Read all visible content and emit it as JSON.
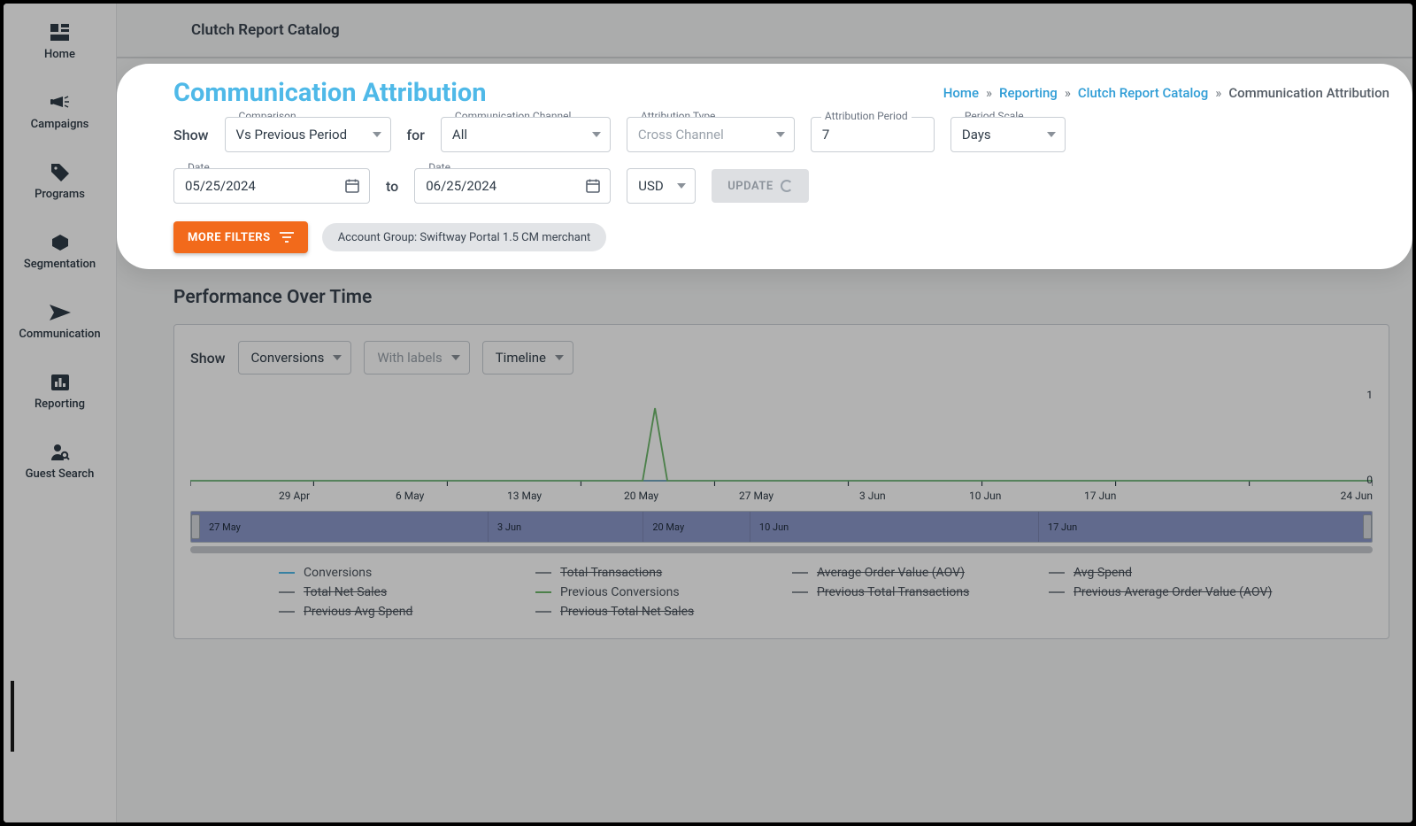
{
  "sidebar": {
    "items": [
      {
        "label": "Home"
      },
      {
        "label": "Campaigns"
      },
      {
        "label": "Programs"
      },
      {
        "label": "Segmentation"
      },
      {
        "label": "Communication"
      },
      {
        "label": "Reporting"
      },
      {
        "label": "Guest Search"
      }
    ]
  },
  "topbar": {
    "catalog_title": "Clutch Report Catalog"
  },
  "breadcrumbs": {
    "home": "Home",
    "reporting": "Reporting",
    "catalog": "Clutch Report Catalog",
    "current": "Communication Attribution",
    "sep": "»"
  },
  "page_title": "Communication Attribution",
  "filters": {
    "show_label": "Show",
    "for_label": "for",
    "to_label": "to",
    "comparison": {
      "float": "Comparison",
      "value": "Vs Previous Period"
    },
    "channel": {
      "float": "Communication Channel",
      "value": "All"
    },
    "attr_type": {
      "float": "Attribution Type",
      "value": "Cross Channel"
    },
    "attr_period": {
      "float": "Attribution Period",
      "value": "7"
    },
    "period_scale": {
      "float": "Period Scale",
      "value": "Days"
    },
    "date_from": {
      "float": "Date",
      "value": "05/25/2024"
    },
    "date_to": {
      "float": "Date",
      "value": "06/25/2024"
    },
    "currency": "USD",
    "update": "UPDATE",
    "more_filters": "MORE FILTERS",
    "chip": "Account Group: Swiftway Portal 1.5 CM merchant"
  },
  "perf": {
    "title": "Performance Over Time",
    "show_label": "Show",
    "metric": "Conversions",
    "labels_btn": "With labels",
    "timeline_btn": "Timeline",
    "y_max": "1",
    "y_min": "0",
    "x_ticks": [
      "29 Apr",
      "6 May",
      "13 May",
      "20 May",
      "27 May",
      "3 Jun",
      "10 Jun",
      "17 Jun",
      "24 Jun"
    ],
    "scrub_ticks": [
      "27 May",
      "3 Jun",
      "20 May",
      "10 Jun",
      "17 Jun"
    ],
    "legend": [
      {
        "label": "Conversions",
        "strike": false,
        "color": "#4fb9e8"
      },
      {
        "label": "Total Transactions",
        "strike": true,
        "color": "#8a9199"
      },
      {
        "label": "Average Order Value (AOV)",
        "strike": true,
        "color": "#8a9199"
      },
      {
        "label": "Avg Spend",
        "strike": true,
        "color": "#8a9199"
      },
      {
        "label": "Total Net Sales",
        "strike": true,
        "color": "#8a9199"
      },
      {
        "label": "Previous Conversions",
        "strike": false,
        "color": "#6db86b"
      },
      {
        "label": "Previous Total Transactions",
        "strike": true,
        "color": "#8a9199"
      },
      {
        "label": "Previous Average Order Value (AOV)",
        "strike": true,
        "color": "#8a9199"
      },
      {
        "label": "Previous Avg Spend",
        "strike": true,
        "color": "#8a9199"
      },
      {
        "label": "Previous Total Net Sales",
        "strike": true,
        "color": "#8a9199"
      }
    ]
  },
  "chart_data": {
    "type": "line",
    "x": [
      "29 Apr",
      "6 May",
      "13 May",
      "20 May",
      "27 May",
      "3 Jun",
      "10 Jun",
      "17 Jun",
      "24 Jun"
    ],
    "series": [
      {
        "name": "Conversions",
        "values": [
          0,
          0,
          0,
          0,
          0,
          0,
          0,
          0,
          0
        ]
      },
      {
        "name": "Previous Conversions",
        "values": [
          0,
          0,
          0,
          0,
          0,
          0,
          0,
          0,
          0
        ],
        "spike_between": [
          "13 May",
          "20 May"
        ],
        "spike_value": 1
      }
    ],
    "ylim": [
      0,
      1
    ],
    "title": "Performance Over Time"
  }
}
